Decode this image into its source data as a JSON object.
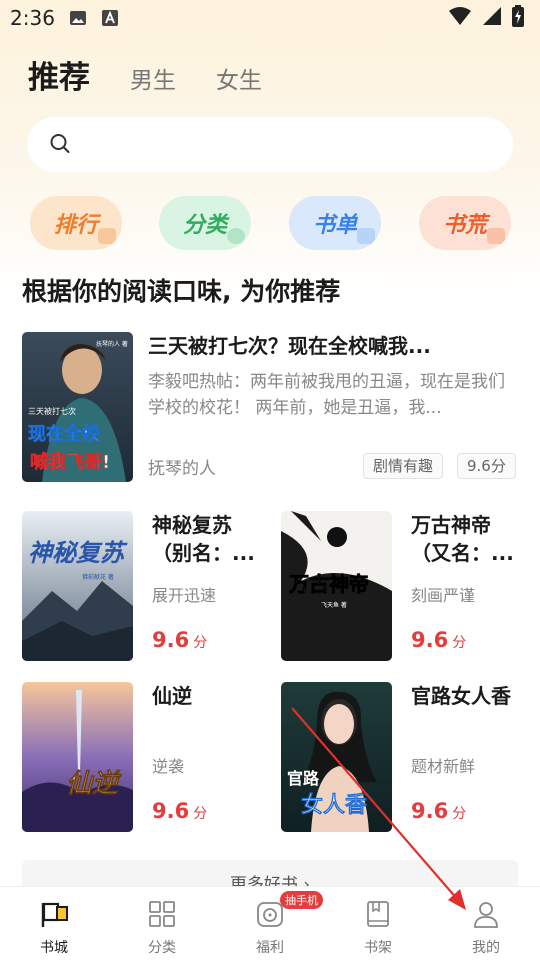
{
  "status_bar": {
    "time": "2:36"
  },
  "tabs": {
    "active": "推荐",
    "items": [
      "男生",
      "女生"
    ]
  },
  "search": {
    "placeholder": ""
  },
  "quick_links": [
    "排行",
    "分类",
    "书单",
    "书荒"
  ],
  "section_title": "根据你的阅读口味, 为你推荐",
  "featured": {
    "title": "三天被打七次？现在全校喊我...",
    "description": "李毅吧热帖：两年前被我甩的丑逼，现在是我们学校的校花！ 两年前，她是丑逼，我...",
    "author": "抚琴的人",
    "tag": "剧情有趣",
    "score": "9.6分",
    "cover_text": [
      "现在全校",
      "喊我飞哥!",
      "三天被打七次",
      "抚琴的人 著"
    ]
  },
  "grid": [
    {
      "title": "神秘复苏（别名：...",
      "tag": "展开迅速",
      "score": "9.6",
      "unit": "分",
      "cover_text": [
        "神秘复苏",
        "佛前献花 著"
      ]
    },
    {
      "title": "万古神帝（又名：...",
      "tag": "刻画严谨",
      "score": "9.6",
      "unit": "分",
      "cover_text": [
        "万古神帝",
        "飞天鱼 著"
      ]
    },
    {
      "title": "仙逆",
      "tag": "逆袭",
      "score": "9.6",
      "unit": "分",
      "cover_text": [
        "仙逆"
      ]
    },
    {
      "title": "官路女人香",
      "tag": "题材新鲜",
      "score": "9.6",
      "unit": "分",
      "cover_text": [
        "官路",
        "女人香"
      ]
    }
  ],
  "more_button": "更多好书 ›",
  "nav": {
    "items": [
      "书城",
      "分类",
      "福利",
      "书架",
      "我的"
    ],
    "badge": "抽手机"
  },
  "colors": {
    "accent_red": "#e43d3d",
    "header_bg": "#fdf2dc"
  }
}
